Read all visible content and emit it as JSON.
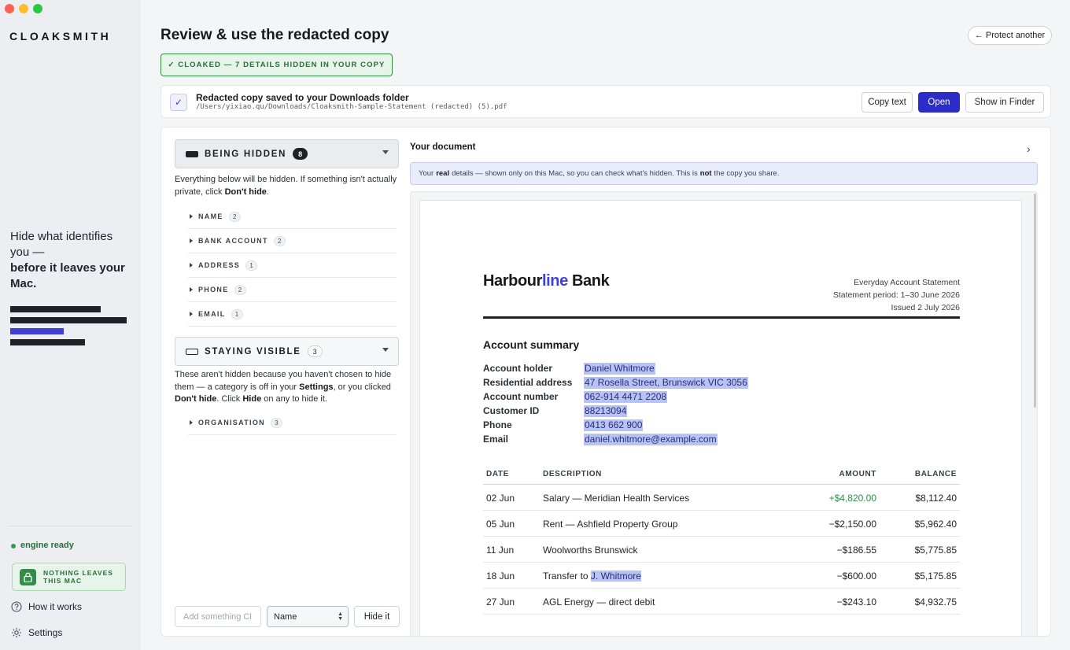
{
  "sidebar": {
    "logo": "CLOAKSMITH",
    "tagline_line1": "Hide what identifies you —",
    "tagline_line2": "before it leaves your Mac.",
    "engine_status": "engine ready",
    "badge": "NOTHING LEAVES THIS MAC",
    "nav": [
      {
        "label": "How it works",
        "icon": "question-circle-icon"
      },
      {
        "label": "Settings",
        "icon": "gear-icon"
      }
    ]
  },
  "header": {
    "title": "Review & use the redacted copy",
    "protect_another": "← Protect another",
    "status_banner": "✓ CLOAKED — 7 DETAILS HIDDEN IN YOUR COPY"
  },
  "saved": {
    "title": "Redacted copy saved to your Downloads folder",
    "path": "/Users/yixiao.qu/Downloads/Cloaksmith-Sample-Statement (redacted) (5).pdf",
    "copy_text": "Copy text",
    "open": "Open",
    "show_in_finder": "Show in Finder"
  },
  "hidden_section": {
    "label": "BEING HIDDEN",
    "count": "8",
    "desc_pre": "Everything below will be hidden. If something isn't actually private, click ",
    "desc_bold": "Don't hide",
    "desc_post": ".",
    "categories": [
      {
        "label": "NAME",
        "count": "2"
      },
      {
        "label": "BANK ACCOUNT",
        "count": "2"
      },
      {
        "label": "ADDRESS",
        "count": "1"
      },
      {
        "label": "PHONE",
        "count": "2"
      },
      {
        "label": "EMAIL",
        "count": "1"
      }
    ]
  },
  "visible_section": {
    "label": "STAYING VISIBLE",
    "count": "3",
    "desc_1": "These aren't hidden because you haven't chosen to hide them — a category is off in your ",
    "desc_settings": "Settings",
    "desc_2": ", or you clicked ",
    "desc_dont": "Don't hide",
    "desc_3": ". Click ",
    "desc_hide": "Hide",
    "desc_4": " on any to hide it.",
    "categories": [
      {
        "label": "ORGANISATION",
        "count": "3"
      }
    ]
  },
  "add": {
    "placeholder": "Add something Cl",
    "select_value": "Name",
    "hide_button": "Hide it"
  },
  "document": {
    "title": "Your document",
    "notice_1": "Your",
    "notice_real": "real",
    "notice_2": "details — shown only on this Mac, so you can check what's hidden. This is",
    "notice_not": "not",
    "notice_3": "the copy you share.",
    "bank_name_1": "Harbour",
    "bank_name_2": "line",
    "bank_name_3": " Bank",
    "statement_lines": [
      "Everyday Account Statement",
      "Statement period: 1–30 June 2026",
      "Issued 2 July 2026"
    ],
    "summary_title": "Account summary",
    "summary": [
      {
        "key": "Account holder",
        "value": "Daniel Whitmore"
      },
      {
        "key": "Residential address",
        "value": "47 Rosella Street, Brunswick VIC 3056"
      },
      {
        "key": "Account number",
        "value": "062-914 4471 2208"
      },
      {
        "key": "Customer ID",
        "value": "88213094"
      },
      {
        "key": "Phone",
        "value": "0413 662 900"
      },
      {
        "key": "Email",
        "value": "daniel.whitmore@example.com"
      }
    ],
    "table_headers": {
      "date": "DATE",
      "description": "DESCRIPTION",
      "amount": "AMOUNT",
      "balance": "BALANCE"
    },
    "transactions": [
      {
        "date": "02 Jun",
        "description": "Salary — Meridian Health Services",
        "amount": "+$4,820.00",
        "balance": "$8,112.40"
      },
      {
        "date": "05 Jun",
        "description": "Rent — Ashfield Property Group",
        "amount": "−$2,150.00",
        "balance": "$5,962.40"
      },
      {
        "date": "11 Jun",
        "description": "Woolworths Brunswick",
        "amount": "−$186.55",
        "balance": "$5,775.85"
      },
      {
        "date": "18 Jun",
        "description": "Transfer to ",
        "description_hl": "J. Whitmore",
        "amount": "−$600.00",
        "balance": "$5,175.85"
      },
      {
        "date": "27 Jun",
        "description": "AGL Energy — direct debit",
        "amount": "−$243.10",
        "balance": "$4,932.75"
      }
    ]
  }
}
